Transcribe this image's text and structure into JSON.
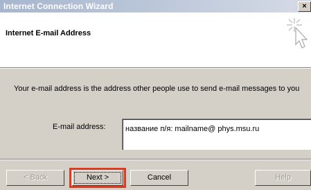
{
  "window": {
    "title": "Internet Connection Wizard",
    "close_glyph": "×"
  },
  "header": {
    "title": "Internet E-mail Address",
    "icon": "pointer-sparkle-icon"
  },
  "body": {
    "description": "Your e-mail address is the address other people use to send e-mail messages to you",
    "email_label": "E-mail address:",
    "email_value": "название п/я: mailname@ phys.msu.ru"
  },
  "buttons": {
    "back": "< Back",
    "next": "Next >",
    "cancel": "Cancel",
    "help": "Help"
  },
  "colors": {
    "titlebar_start": "#a7b6cf",
    "dialog_face": "#d4d0c8",
    "highlight": "#e03a1e"
  }
}
